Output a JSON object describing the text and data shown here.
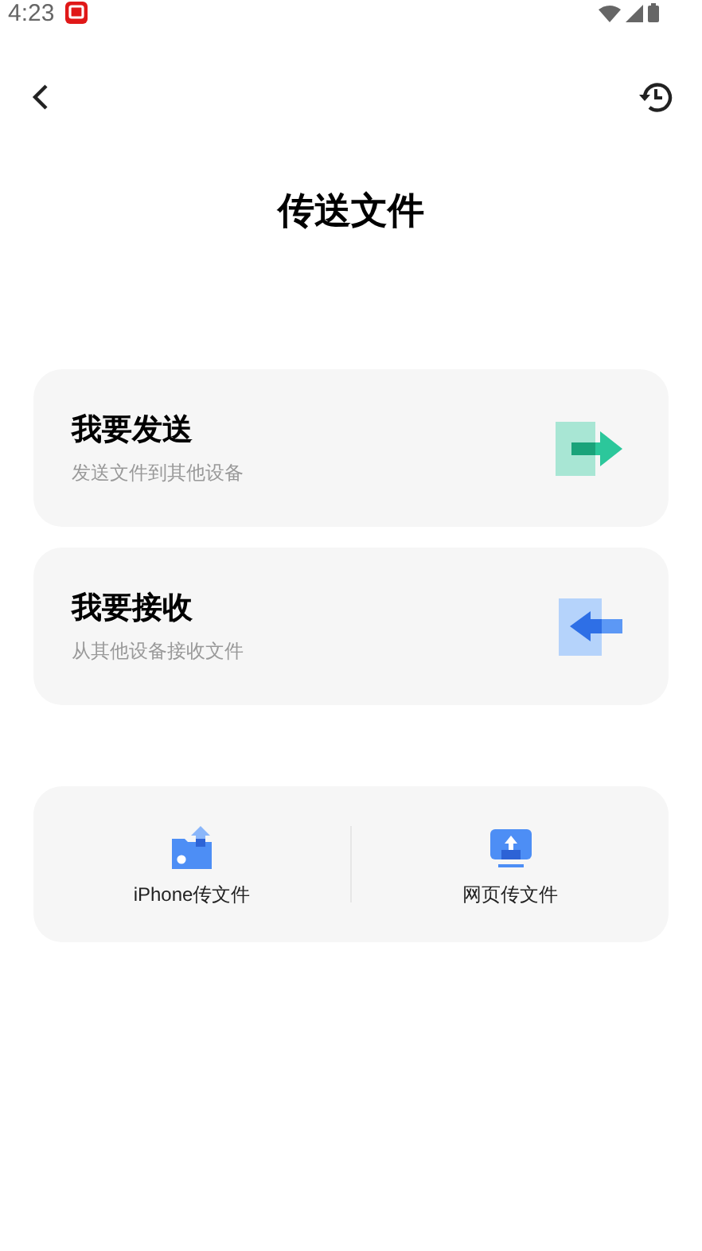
{
  "status_bar": {
    "time": "4:23"
  },
  "title": "传送文件",
  "options": [
    {
      "kind": "send",
      "title": "我要发送",
      "subtitle": "发送文件到其他设备"
    },
    {
      "kind": "receive",
      "title": "我要接收",
      "subtitle": "从其他设备接收文件"
    }
  ],
  "shortcuts": [
    {
      "kind": "iphone",
      "label": "iPhone传文件"
    },
    {
      "kind": "web",
      "label": "网页传文件"
    }
  ]
}
